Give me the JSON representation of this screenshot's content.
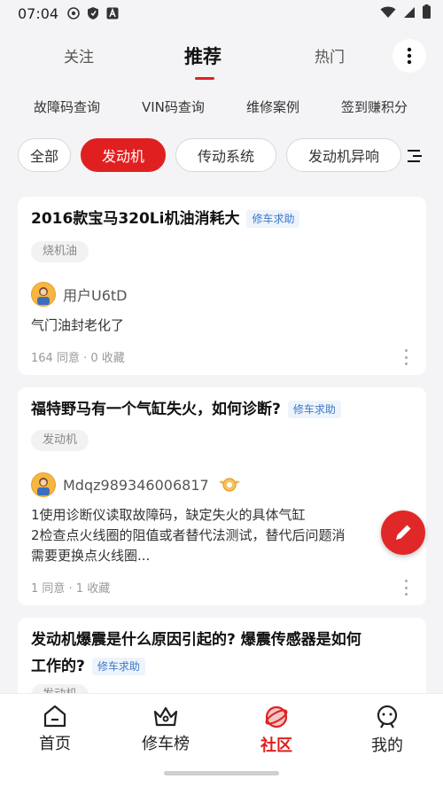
{
  "status_bar": {
    "time": "07:04"
  },
  "top_tabs": [
    {
      "label": "关注"
    },
    {
      "label": "推荐"
    },
    {
      "label": "热门"
    }
  ],
  "quick_links": [
    "故障码查询",
    "VIN码查询",
    "维修案例",
    "签到赚积分"
  ],
  "chips": [
    "全部",
    "发动机",
    "传动系统",
    "发动机异响"
  ],
  "posts": [
    {
      "title": "2016款宝马320Li机油消耗大",
      "badge": "修车求助",
      "tag": "烧机油",
      "user": "用户U6tD",
      "body": "气门油封老化了",
      "stats": "164 同意 · 0 收藏"
    },
    {
      "title": "福特野马有一个气缸失火，如何诊断?",
      "badge": "修车求助",
      "tag": "发动机",
      "user": "Mdqz989346006817",
      "body": "1使用诊断仪读取故障码，缺定失火的具体气缸\n2检查点火线圈的阻值或者替代法测试，替代后问题消\n需要更换点火线圈...",
      "stats": "1 同意 · 1 收藏"
    },
    {
      "title": "发动机爆震是什么原因引起的? 爆震传感器是如何",
      "title_line2": "工作的?",
      "badge": "修车求助",
      "tag": "发动机"
    }
  ],
  "bottom_nav": [
    {
      "label": "首页"
    },
    {
      "label": "修车榜"
    },
    {
      "label": "社区"
    },
    {
      "label": "我的"
    }
  ],
  "colors": {
    "accent": "#e02020",
    "badge_text": "#3b78c9",
    "background": "#f4f4f6"
  }
}
